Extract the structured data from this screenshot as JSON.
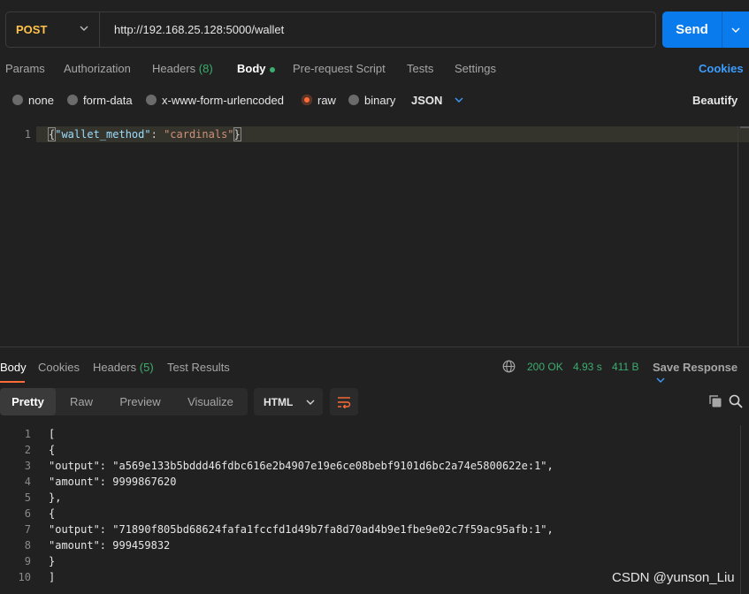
{
  "request": {
    "method": "POST",
    "url": "http://192.168.25.128:5000/wallet",
    "send_label": "Send"
  },
  "request_tabs": {
    "params": "Params",
    "authorization": "Authorization",
    "headers": "Headers",
    "headers_count": "(8)",
    "body": "Body",
    "pre_request": "Pre-request Script",
    "tests": "Tests",
    "settings": "Settings",
    "cookies": "Cookies"
  },
  "body_types": {
    "none": "none",
    "form_data": "form-data",
    "urlencoded": "x-www-form-urlencoded",
    "raw": "raw",
    "binary": "binary",
    "format": "JSON",
    "beautify": "Beautify"
  },
  "request_body": {
    "line_number": "1",
    "open_brace": "{",
    "key": "\"wallet_method\"",
    "colon": ": ",
    "value": "\"cardinals\"",
    "close_brace": "}"
  },
  "response_tabs": {
    "body": "Body",
    "cookies": "Cookies",
    "headers": "Headers",
    "headers_count": "(5)",
    "test_results": "Test Results"
  },
  "response_status": {
    "code": "200 OK",
    "time": "4.93 s",
    "size": "411 B",
    "save": "Save Response"
  },
  "view_modes": {
    "pretty": "Pretty",
    "raw": "Raw",
    "preview": "Preview",
    "visualize": "Visualize",
    "format": "HTML"
  },
  "response_lines": [
    {
      "n": "1",
      "text": "["
    },
    {
      "n": "2",
      "text": "{"
    },
    {
      "n": "3",
      "text": "\"output\": \"a569e133b5bddd46fdbc616e2b4907e19e6ce08bebf9101d6bc2a74e5800622e:1\","
    },
    {
      "n": "4",
      "text": "\"amount\": 9999867620"
    },
    {
      "n": "5",
      "text": "},"
    },
    {
      "n": "6",
      "text": "{"
    },
    {
      "n": "7",
      "text": "\"output\": \"71890f805bd68624fafa1fccfd1d49b7fa8d70ad4b9e1fbe9e02c7f59ac95afb:1\","
    },
    {
      "n": "8",
      "text": "\"amount\": 999459832"
    },
    {
      "n": "9",
      "text": "}"
    },
    {
      "n": "10",
      "text": "]"
    }
  ],
  "watermark": "CSDN @yunson_Liu",
  "colors": {
    "accent_orange": "#ff6c37",
    "send_blue": "#097bed",
    "link_blue": "#3c9dff",
    "status_green": "#3cad6e",
    "method_yellow": "#ffc24b"
  }
}
